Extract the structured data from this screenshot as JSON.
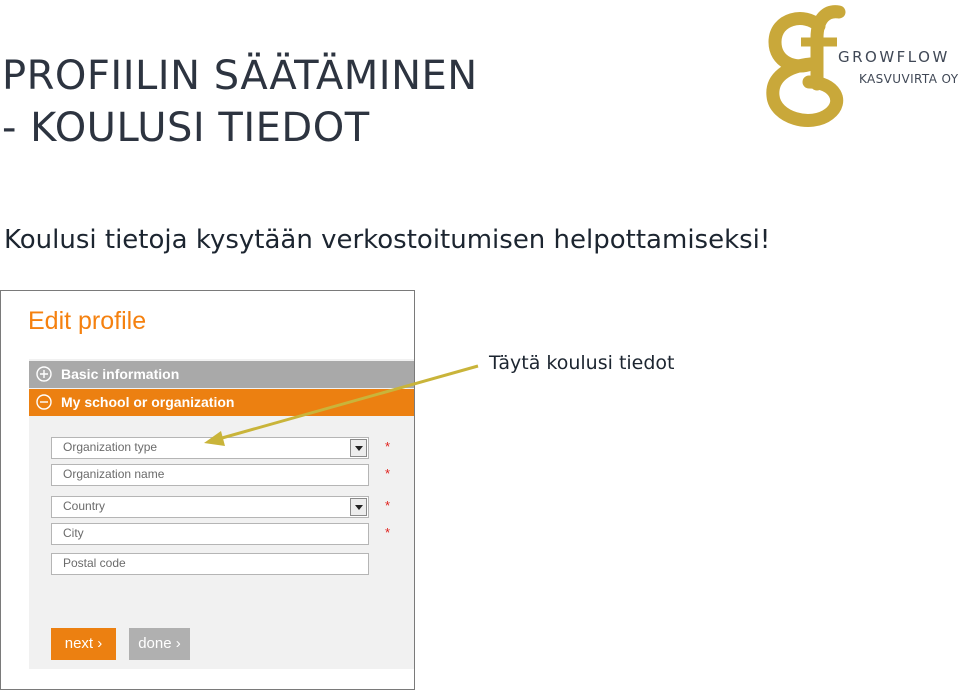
{
  "title": {
    "line1": "PROFIILIN SÄÄTÄMINEN",
    "line2": "- KOULUSI TIEDOT"
  },
  "subtitle": "Koulusi tietoja kysytään verkostoitumisen helpottamiseksi!",
  "logo": {
    "word": "GROWFLOW",
    "sub": "KASVUVIRTA OY",
    "color": "#c9a83a"
  },
  "screenshot": {
    "heading": "Edit profile",
    "sections": [
      {
        "label": "Basic information",
        "icon": "plus-circle-icon"
      },
      {
        "label": "My school or organization",
        "icon": "minus-circle-icon"
      }
    ],
    "fields": [
      {
        "label": "Organization type",
        "type": "select",
        "required": true
      },
      {
        "label": "Organization name",
        "type": "text",
        "required": true
      },
      {
        "label": "Country",
        "type": "select",
        "required": true
      },
      {
        "label": "City",
        "type": "text",
        "required": true
      },
      {
        "label": "Postal code",
        "type": "text",
        "required": false
      }
    ],
    "required_mark": "*",
    "buttons": {
      "next": "next ›",
      "done": "done ›"
    }
  },
  "callout": "Täytä koulusi tiedot",
  "colors": {
    "accent": "#ec8011",
    "arrow": "#c9b43a",
    "section_gray": "#a9a9a9"
  }
}
